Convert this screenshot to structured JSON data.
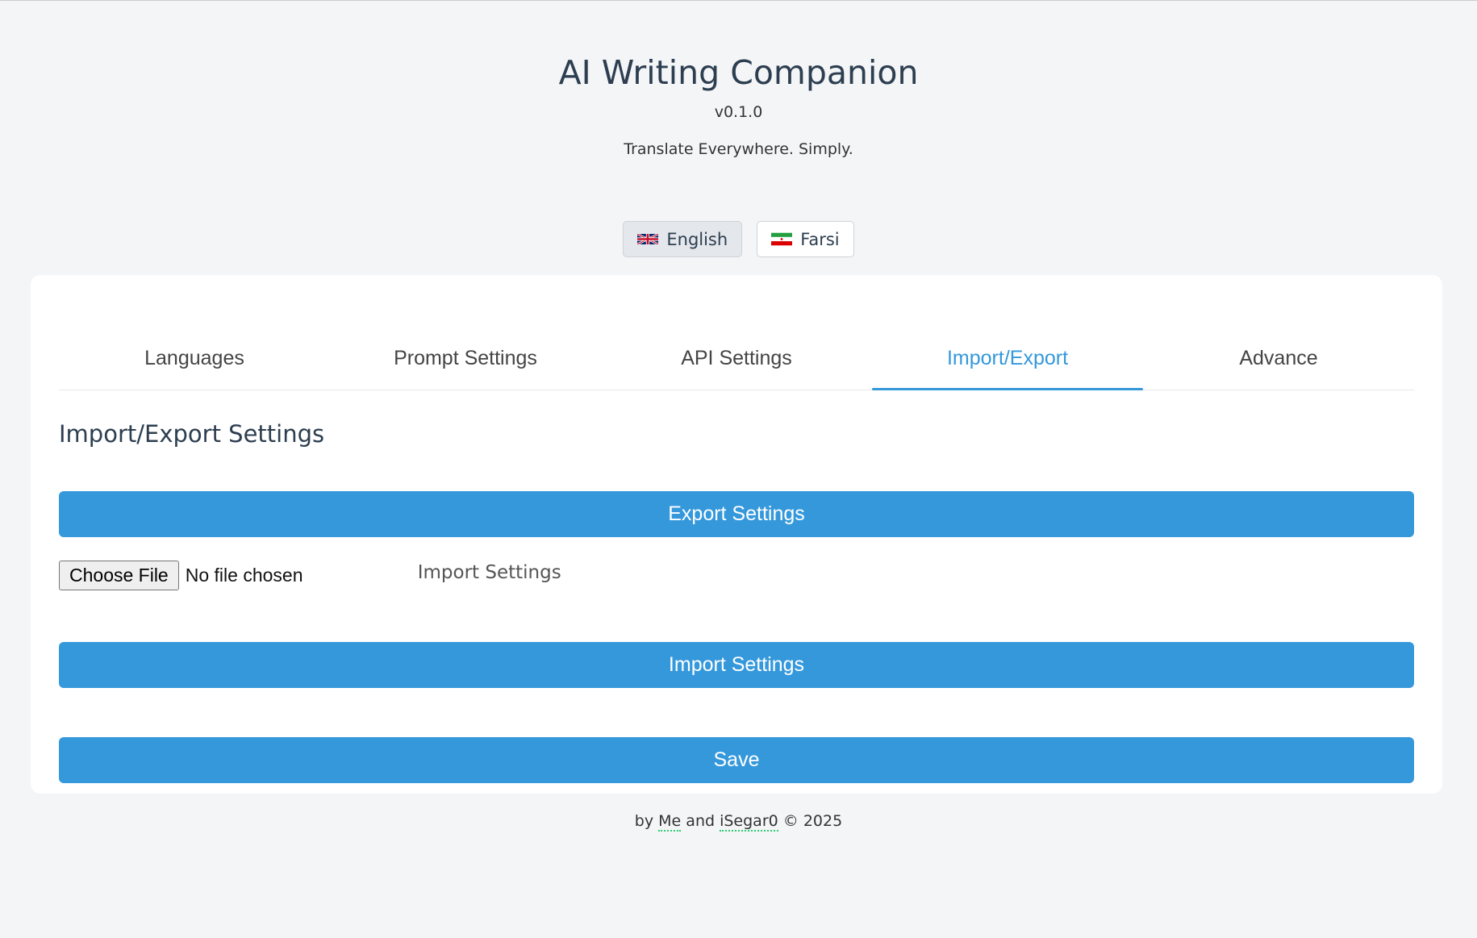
{
  "header": {
    "title": "AI Writing Companion",
    "version": "v0.1.0",
    "tagline": "Translate Everywhere. Simply."
  },
  "language_switch": {
    "english_label": "English",
    "english_icon": "uk-flag-icon",
    "farsi_label": "Farsi",
    "farsi_icon": "iran-flag-icon",
    "selected": "English"
  },
  "tabs": [
    {
      "label": "Languages"
    },
    {
      "label": "Prompt Settings"
    },
    {
      "label": "API Settings"
    },
    {
      "label": "Import/Export"
    },
    {
      "label": "Advance"
    }
  ],
  "active_tab": "Import/Export",
  "import_export": {
    "section_title": "Import/Export Settings",
    "export_button": "Export Settings",
    "choose_file_button": "Choose File",
    "file_status": "No file chosen",
    "import_label": "Import Settings",
    "import_button": "Import Settings"
  },
  "save_button": "Save",
  "footer": {
    "prefix": "by",
    "author1": "Me",
    "conjunction": "and",
    "author2": "iSegar0",
    "copyright": "© 2025"
  },
  "colors": {
    "accent": "#3498db",
    "background": "#f4f5f7",
    "card": "#ffffff",
    "link_underline": "#2ecc71"
  }
}
